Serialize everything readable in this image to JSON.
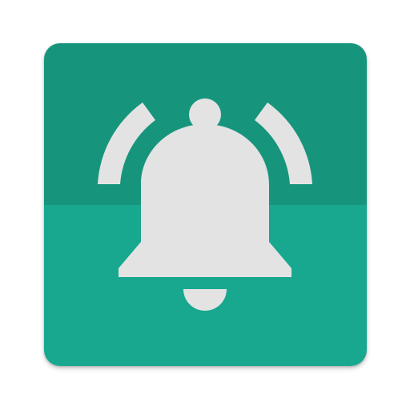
{
  "app_icon": {
    "icon": "bell-icon",
    "colors": {
      "tile_top": "#17957C",
      "tile_bottom": "#17A88F",
      "glyph": "#E3E3E3"
    }
  }
}
